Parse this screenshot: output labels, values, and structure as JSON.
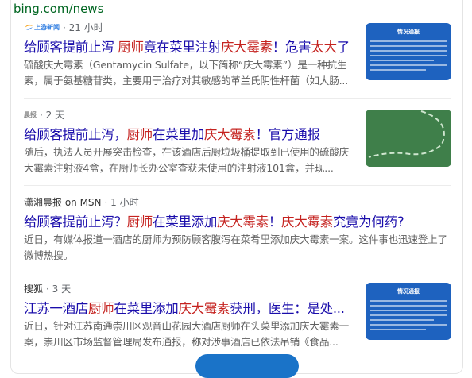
{
  "site_url": "bing.com/news",
  "results": [
    {
      "source_logo": "上游新闻",
      "time": "· 21 小时",
      "title_parts": [
        {
          "t": "给顾客提前止泻 ",
          "hl": false
        },
        {
          "t": "厨师",
          "hl": true
        },
        {
          "t": "竟在菜里注射",
          "hl": false
        },
        {
          "t": "庆大霉素",
          "hl": true
        },
        {
          "t": "！危害",
          "hl": false
        },
        {
          "t": "太大",
          "hl": true
        },
        {
          "t": "了",
          "hl": false
        }
      ],
      "snippet": "硫酸庆大霉素（Gentamycin Sulfate，以下简称“庆大霉素”）是一种抗生素，属于氨基糖苷类，主要用于治疗对其敏感的革兰氏阴性杆菌（如大肠...",
      "thumb_title": "情况通报"
    },
    {
      "source_logo": "晨报",
      "time": "· 2 天",
      "title_parts": [
        {
          "t": "给顾客提前止泻，",
          "hl": false
        },
        {
          "t": "厨师",
          "hl": true
        },
        {
          "t": "在菜里加",
          "hl": false
        },
        {
          "t": "庆大霉素",
          "hl": true
        },
        {
          "t": "！官方通报",
          "hl": false
        }
      ],
      "snippet": "随后，执法人员开展突击检查，在该酒店后厨垃圾桶提取到已使用的硫酸庆大霉素注射液4盒，在厨师长办公室查获未使用的注射液101盒，并现..."
    },
    {
      "source": "潇湘晨报 on MSN",
      "time": "· 1 小时",
      "title_parts": [
        {
          "t": "给顾客提前止泻？",
          "hl": false
        },
        {
          "t": "厨师",
          "hl": true
        },
        {
          "t": "在菜里添加",
          "hl": false
        },
        {
          "t": "庆大霉素",
          "hl": true
        },
        {
          "t": "！",
          "hl": false
        },
        {
          "t": "庆大霉素",
          "hl": true
        },
        {
          "t": "究竟为何药?",
          "hl": false
        }
      ],
      "snippet": "近日，有媒体报道一酒店的厨师为预防顾客腹泻在菜肴里添加庆大霉素一案。这件事也迅速登上了微博热搜。"
    },
    {
      "source": "搜狐",
      "time": "· 3 天",
      "title_parts": [
        {
          "t": "江苏一酒店",
          "hl": false
        },
        {
          "t": "厨师",
          "hl": true
        },
        {
          "t": "在菜里添加",
          "hl": false
        },
        {
          "t": "庆大霉素",
          "hl": true
        },
        {
          "t": "获刑，医生：是处...",
          "hl": false
        }
      ],
      "snippet": "近日，针对江苏南通崇川区观音山花园大酒店厨师在头菜里添加庆大霉素一案，崇川区市场监督管理局发布通报，称对涉事酒店已依法吊销《食品...",
      "thumb_title": "情况通报"
    }
  ]
}
